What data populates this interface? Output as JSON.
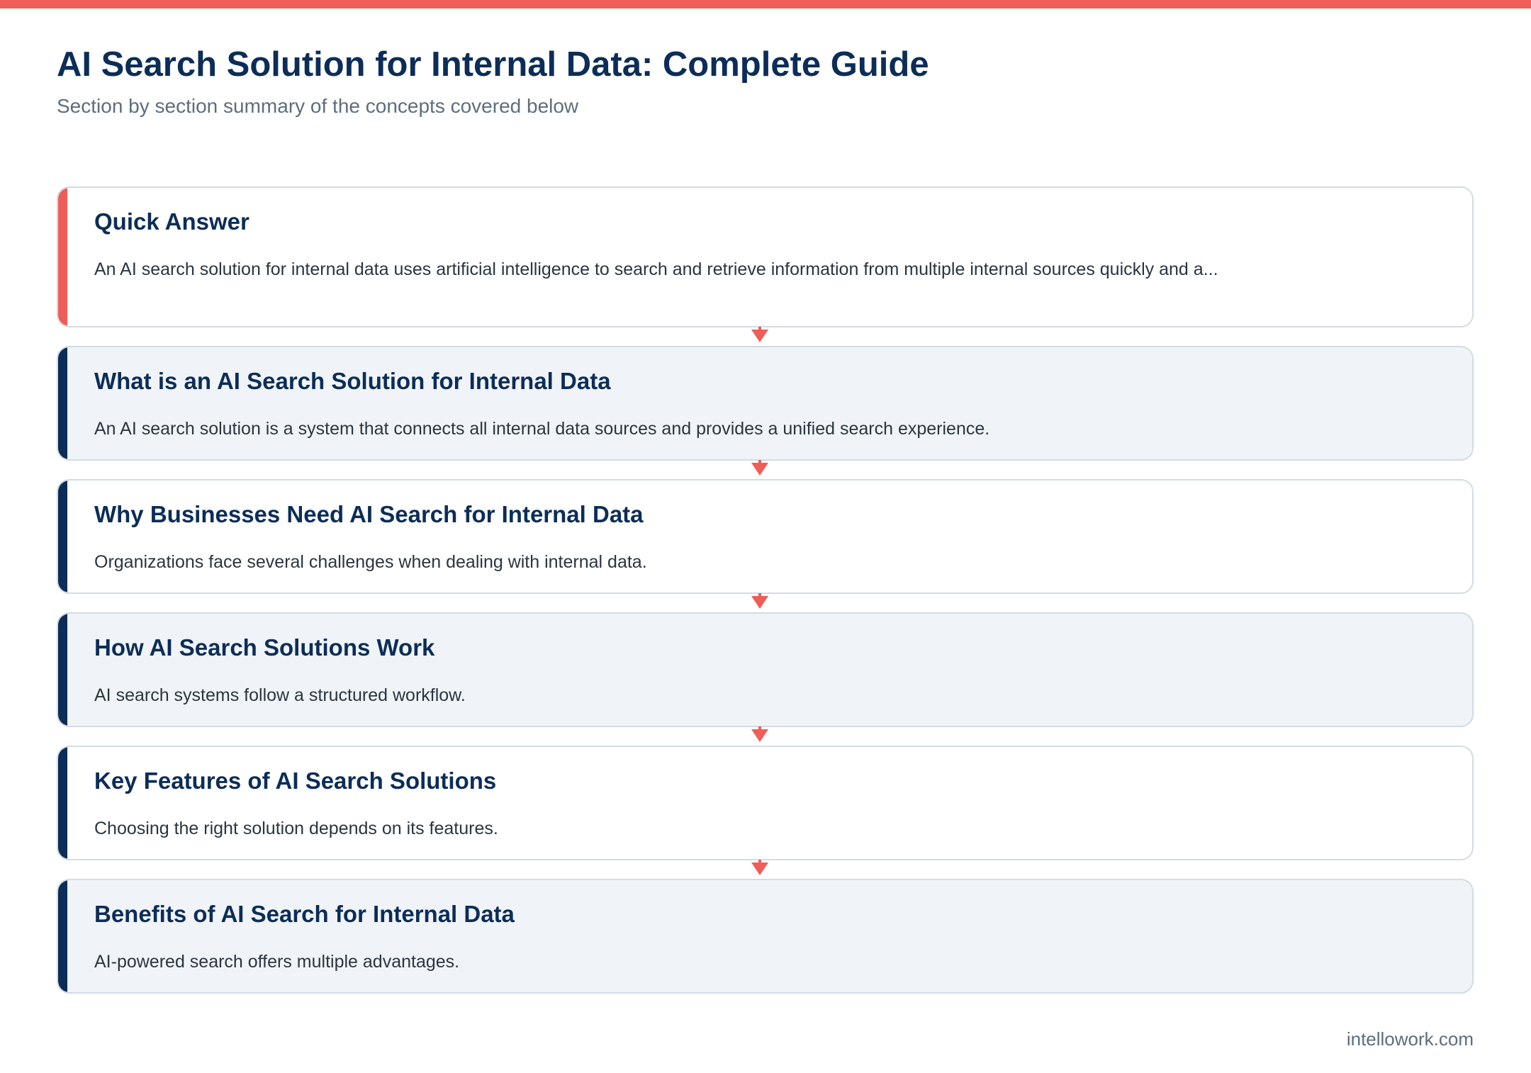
{
  "header": {
    "title": "AI Search Solution for Internal Data: Complete Guide",
    "subtitle": "Section by section summary of the concepts covered below"
  },
  "colors": {
    "accent_coral": "#ef5d58",
    "navy": "#0c2d57",
    "card_alt_bg": "#f0f4f8"
  },
  "steps": [
    {
      "title": "Quick Answer",
      "text": "An AI search solution for internal data uses artificial intelligence to search and retrieve information from multiple internal sources quickly and a..."
    },
    {
      "title": "What is an AI Search Solution for Internal Data",
      "text": "An AI search solution is a system that connects all internal data sources and provides a unified search experience."
    },
    {
      "title": "Why Businesses Need AI Search for Internal Data",
      "text": "Organizations face several challenges when dealing with internal data."
    },
    {
      "title": "How AI Search Solutions Work",
      "text": "AI search systems follow a structured workflow."
    },
    {
      "title": "Key Features of AI Search Solutions",
      "text": "Choosing the right solution depends on its features."
    },
    {
      "title": "Benefits of AI Search for Internal Data",
      "text": "AI-powered search offers multiple advantages."
    }
  ],
  "footer": {
    "credit": "intellowork.com"
  }
}
